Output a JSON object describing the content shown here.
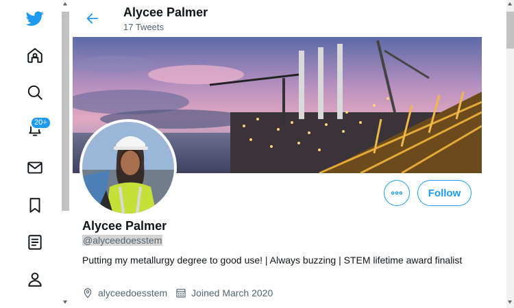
{
  "brand": {
    "logo_icon": "twitter-bird-icon",
    "accent": "#1d9bf0"
  },
  "nav": {
    "items": [
      {
        "name": "home",
        "icon": "home-icon"
      },
      {
        "name": "explore",
        "icon": "search-icon"
      },
      {
        "name": "notifications",
        "icon": "bell-icon",
        "badge": "20+"
      },
      {
        "name": "messages",
        "icon": "mail-icon"
      },
      {
        "name": "bookmarks",
        "icon": "bookmark-icon"
      },
      {
        "name": "lists",
        "icon": "list-icon"
      },
      {
        "name": "profile",
        "icon": "person-icon"
      }
    ]
  },
  "header": {
    "name": "Alycee Palmer",
    "tweet_count": "17 Tweets"
  },
  "profile": {
    "name": "Alycee Palmer",
    "handle": "@alyceedoesstem",
    "bio": "Putting my metallurgy degree to good use! | Always buzzing | STEM lifetime award finalist",
    "location": "alyceedoesstem",
    "joined": "Joined March 2020"
  },
  "actions": {
    "follow_label": "Follow",
    "more_icon": "more-dots-icon"
  }
}
